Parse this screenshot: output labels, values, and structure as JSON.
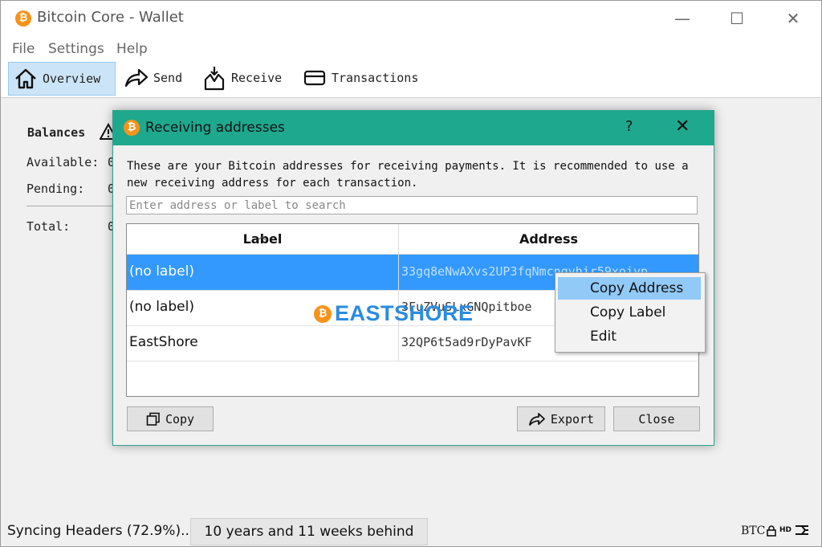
{
  "window": {
    "title": "Bitcoin Core - Wallet",
    "icon_glyph": "₿",
    "controls": [
      "minimize-icon",
      "maximize-icon",
      "close-icon"
    ]
  },
  "menu": {
    "file": "File",
    "settings": "Settings",
    "help": "Help"
  },
  "toolbar": {
    "overview": "Overview",
    "send": "Send",
    "receive": "Receive",
    "transactions": "Transactions"
  },
  "overview": {
    "balances": "Balances",
    "available": "Available:",
    "available_value": "0",
    "pending": "Pending:",
    "pending_value": "0",
    "total": "Total:",
    "total_value": "0"
  },
  "dialog": {
    "title": "Receiving addresses",
    "help": "?",
    "description": "These are your Bitcoin addresses for receiving payments. It is recommended to use a new receiving address for each transaction.",
    "search_placeholder": "Enter address or label to search",
    "columns": [
      "Label",
      "Address"
    ],
    "rows": [
      {
        "label": "(no label)",
        "address": "33gq8eNwAXvs2UP3fqNmcnqvhir59xoiyp"
      },
      {
        "label": "(no label)",
        "address": "3FuZVuSLxGNQpitboe"
      },
      {
        "label": "EastShore",
        "address": "32QP6t5ad9rDyPavKF"
      }
    ],
    "selected_row": 0,
    "buttons": {
      "copy": "Copy",
      "export": "Export",
      "close": "Close"
    }
  },
  "context_menu": {
    "items": [
      "Copy Address",
      "Copy Label",
      "Edit"
    ],
    "highlighted": 0
  },
  "watermark": {
    "text": "EASTSHORE",
    "glyph": "₿"
  },
  "statusbar": {
    "sync": "Syncing Headers (72.9%)...",
    "behind": "10 years and 11 weeks behind",
    "unit": "BTC"
  },
  "colors": {
    "dialog_title": "#1ea88e",
    "selection": "#3399ff",
    "context_highlight": "#91c9f7",
    "bitcoin_orange": "#f7931a",
    "toolbar_active": "#cce4f7"
  }
}
